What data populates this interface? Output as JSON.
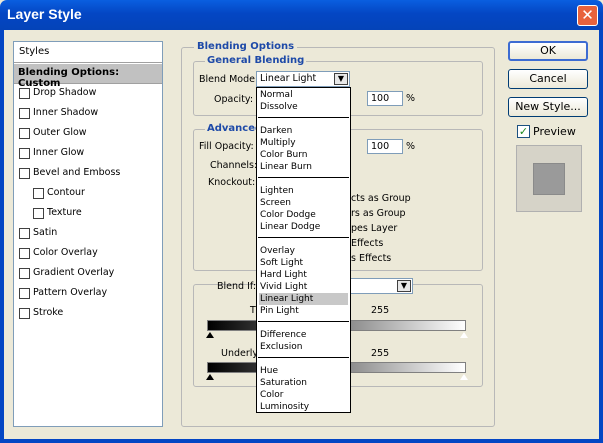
{
  "window": {
    "title": "Layer Style",
    "close_glyph": "✕"
  },
  "styles_panel": {
    "header": "Styles",
    "selected": "Blending Options: Custom",
    "items": [
      {
        "label": "Drop Shadow",
        "sub": false
      },
      {
        "label": "Inner Shadow",
        "sub": false
      },
      {
        "label": "Outer Glow",
        "sub": false
      },
      {
        "label": "Inner Glow",
        "sub": false
      },
      {
        "label": "Bevel and Emboss",
        "sub": false
      },
      {
        "label": "Contour",
        "sub": true
      },
      {
        "label": "Texture",
        "sub": true
      },
      {
        "label": "Satin",
        "sub": false
      },
      {
        "label": "Color Overlay",
        "sub": false
      },
      {
        "label": "Gradient Overlay",
        "sub": false
      },
      {
        "label": "Pattern Overlay",
        "sub": false
      },
      {
        "label": "Stroke",
        "sub": false
      }
    ]
  },
  "blending": {
    "title": "Blending Options",
    "general_title": "General Blending",
    "blend_mode_label": "Blend Mode:",
    "blend_mode_value": "Linear Light",
    "opacity_label": "Opacity:",
    "opacity_value": "100",
    "percent": "%",
    "advanced_title": "Advanced",
    "fill_opacity_label": "Fill Opacity:",
    "fill_opacity_value": "100",
    "channels_label": "Channels:",
    "knockout_label": "Knockout:",
    "partial_options": [
      "cts as Group",
      "rs as Group",
      "pes Layer",
      "Effects",
      "s Effects"
    ],
    "blend_if_label": "Blend If:",
    "this_layer_partial": "Th",
    "underlying_partial": "Underlyi",
    "this_layer_value": "255",
    "underlying_value": "255"
  },
  "blend_menu": {
    "groups": [
      [
        "Normal",
        "Dissolve"
      ],
      [
        "Darken",
        "Multiply",
        "Color Burn",
        "Linear Burn"
      ],
      [
        "Lighten",
        "Screen",
        "Color Dodge",
        "Linear Dodge"
      ],
      [
        "Overlay",
        "Soft Light",
        "Hard Light",
        "Vivid Light",
        "Linear Light",
        "Pin Light"
      ],
      [
        "Difference",
        "Exclusion"
      ],
      [
        "Hue",
        "Saturation",
        "Color",
        "Luminosity"
      ]
    ],
    "selected": "Linear Light"
  },
  "buttons": {
    "ok": "OK",
    "cancel": "Cancel",
    "new_style": "New Style...",
    "preview": "Preview"
  }
}
